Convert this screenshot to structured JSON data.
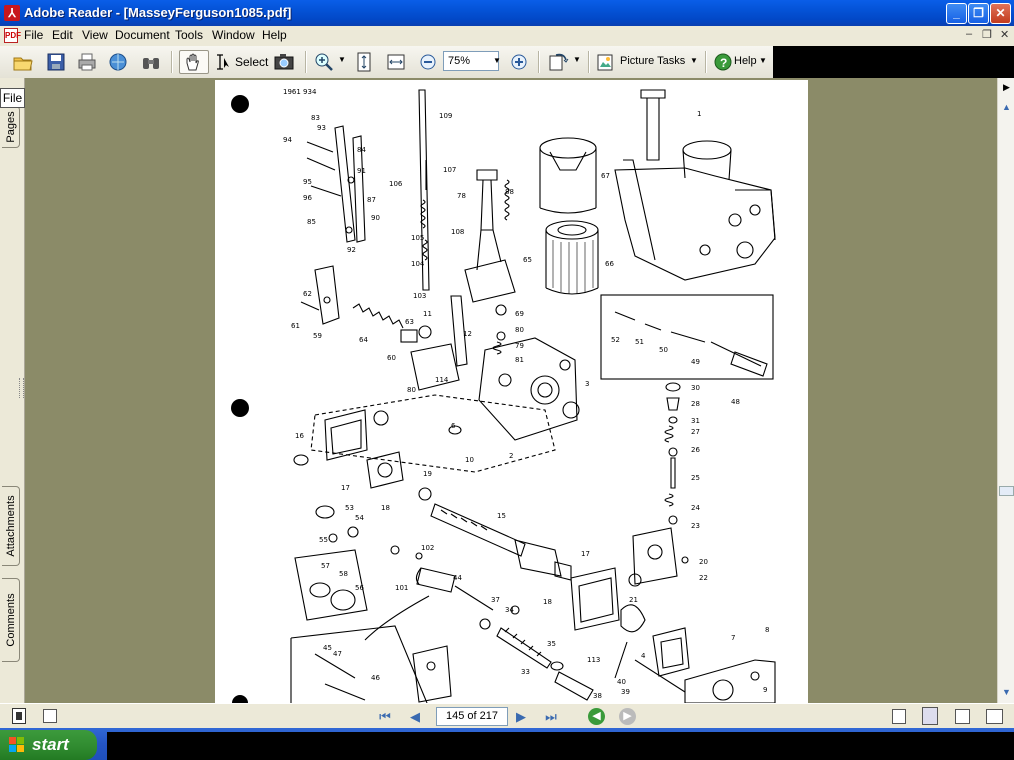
{
  "window": {
    "title": "Adobe Reader - [MasseyFerguson1085.pdf]",
    "app_icon": "adobe-reader-icon"
  },
  "window_controls": {
    "minimize": "_",
    "maximize": "❐",
    "close": "✕"
  },
  "menu": {
    "items": [
      "File",
      "Edit",
      "View",
      "Document",
      "Tools",
      "Window",
      "Help"
    ],
    "mdi": [
      "–",
      "❐",
      "✕"
    ]
  },
  "toolbar": {
    "select_label": "Select",
    "zoom_value": "75%",
    "picture_tasks_label": "Picture Tasks",
    "help_label": "Help"
  },
  "left_panel": {
    "file_label": "File",
    "pages_tab": "Pages",
    "attachments_tab": "Attachments",
    "comments_tab": "Comments"
  },
  "page": {
    "header": "1961  934",
    "labels": [
      {
        "t": "83"
      },
      {
        "t": "93"
      },
      {
        "t": "94"
      },
      {
        "t": "84"
      },
      {
        "t": "91"
      },
      {
        "t": "95"
      },
      {
        "t": "96"
      },
      {
        "t": "87"
      },
      {
        "t": "85"
      },
      {
        "t": "90"
      },
      {
        "t": "92"
      },
      {
        "t": "109"
      },
      {
        "t": "107"
      },
      {
        "t": "106"
      },
      {
        "t": "78"
      },
      {
        "t": "88"
      },
      {
        "t": "67"
      },
      {
        "t": "105"
      },
      {
        "t": "108"
      },
      {
        "t": "104"
      },
      {
        "t": "65"
      },
      {
        "t": "66"
      },
      {
        "t": "103"
      },
      {
        "t": "62"
      },
      {
        "t": "61"
      },
      {
        "t": "59"
      },
      {
        "t": "64"
      },
      {
        "t": "63"
      },
      {
        "t": "11"
      },
      {
        "t": "69"
      },
      {
        "t": "80"
      },
      {
        "t": "79"
      },
      {
        "t": "81"
      },
      {
        "t": "12"
      },
      {
        "t": "60"
      },
      {
        "t": "114"
      },
      {
        "t": "3"
      },
      {
        "t": "6"
      },
      {
        "t": "10"
      },
      {
        "t": "2"
      },
      {
        "t": "52"
      },
      {
        "t": "51"
      },
      {
        "t": "50"
      },
      {
        "t": "49"
      },
      {
        "t": "48"
      },
      {
        "t": "30"
      },
      {
        "t": "28"
      },
      {
        "t": "31"
      },
      {
        "t": "27"
      },
      {
        "t": "26"
      },
      {
        "t": "25"
      },
      {
        "t": "24"
      },
      {
        "t": "23"
      },
      {
        "t": "20"
      },
      {
        "t": "22"
      },
      {
        "t": "16"
      },
      {
        "t": "17"
      },
      {
        "t": "18"
      },
      {
        "t": "19"
      },
      {
        "t": "15"
      },
      {
        "t": "55"
      },
      {
        "t": "53"
      },
      {
        "t": "54"
      },
      {
        "t": "102"
      },
      {
        "t": "101"
      },
      {
        "t": "44"
      },
      {
        "t": "57"
      },
      {
        "t": "58"
      },
      {
        "t": "56"
      },
      {
        "t": "17"
      },
      {
        "t": "21"
      },
      {
        "t": "37"
      },
      {
        "t": "34"
      },
      {
        "t": "18"
      },
      {
        "t": "35"
      },
      {
        "t": "33"
      },
      {
        "t": "113"
      },
      {
        "t": "40"
      },
      {
        "t": "39"
      },
      {
        "t": "38"
      },
      {
        "t": "45"
      },
      {
        "t": "47"
      },
      {
        "t": "46"
      },
      {
        "t": "4"
      },
      {
        "t": "7"
      },
      {
        "t": "8"
      },
      {
        "t": "9"
      },
      {
        "t": "1"
      },
      {
        "t": "80"
      }
    ]
  },
  "status": {
    "page_indicator": "145 of 217"
  },
  "taskbar": {
    "start_label": "start"
  },
  "colors": {
    "title_blue": "#0452d6",
    "doc_background": "#8b8b68",
    "start_green": "#2f8a2f"
  }
}
